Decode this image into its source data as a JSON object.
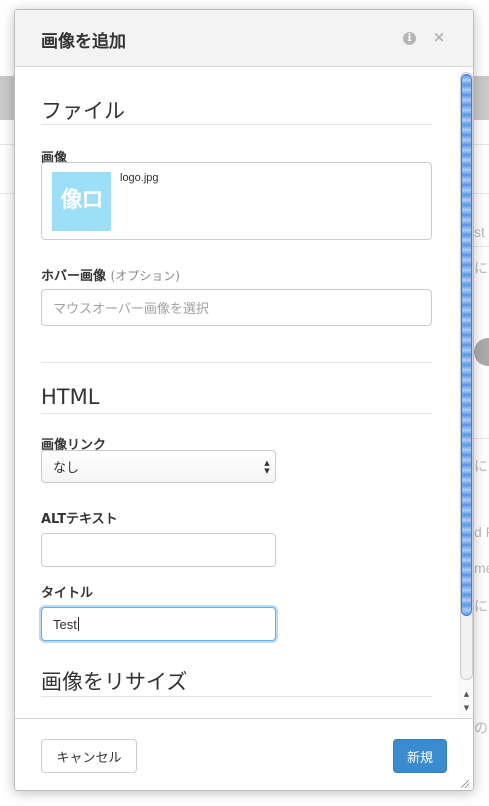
{
  "modal": {
    "title": "画像を追加",
    "info_icon": "i",
    "close_icon": "×"
  },
  "file_section": {
    "title": "ファイル",
    "image_label": "画像",
    "thumbnail_text": "像ロ",
    "file_name": "logo.jpg",
    "hover_label": "ホバー画像",
    "hover_optional": "(オプション)",
    "hover_placeholder": "マウスオーバー画像を選択"
  },
  "html_section": {
    "title": "HTML",
    "link_label": "画像リンク",
    "link_value": "なし",
    "alt_label": "ALTテキスト",
    "alt_value": "",
    "title_label": "タイトル",
    "title_value": "Test"
  },
  "resize_section": {
    "title": "画像をリサイズ"
  },
  "footer": {
    "cancel_label": "キャンセル",
    "new_label": "新規"
  },
  "background": {
    "texts": [
      "st",
      "にタ",
      "にア",
      "d F",
      "me",
      "にタ",
      "の"
    ]
  },
  "colors": {
    "primary_button": "#3a8bd0",
    "focus_border": "#66afe9",
    "thumbnail_bg": "#9cdff7"
  }
}
